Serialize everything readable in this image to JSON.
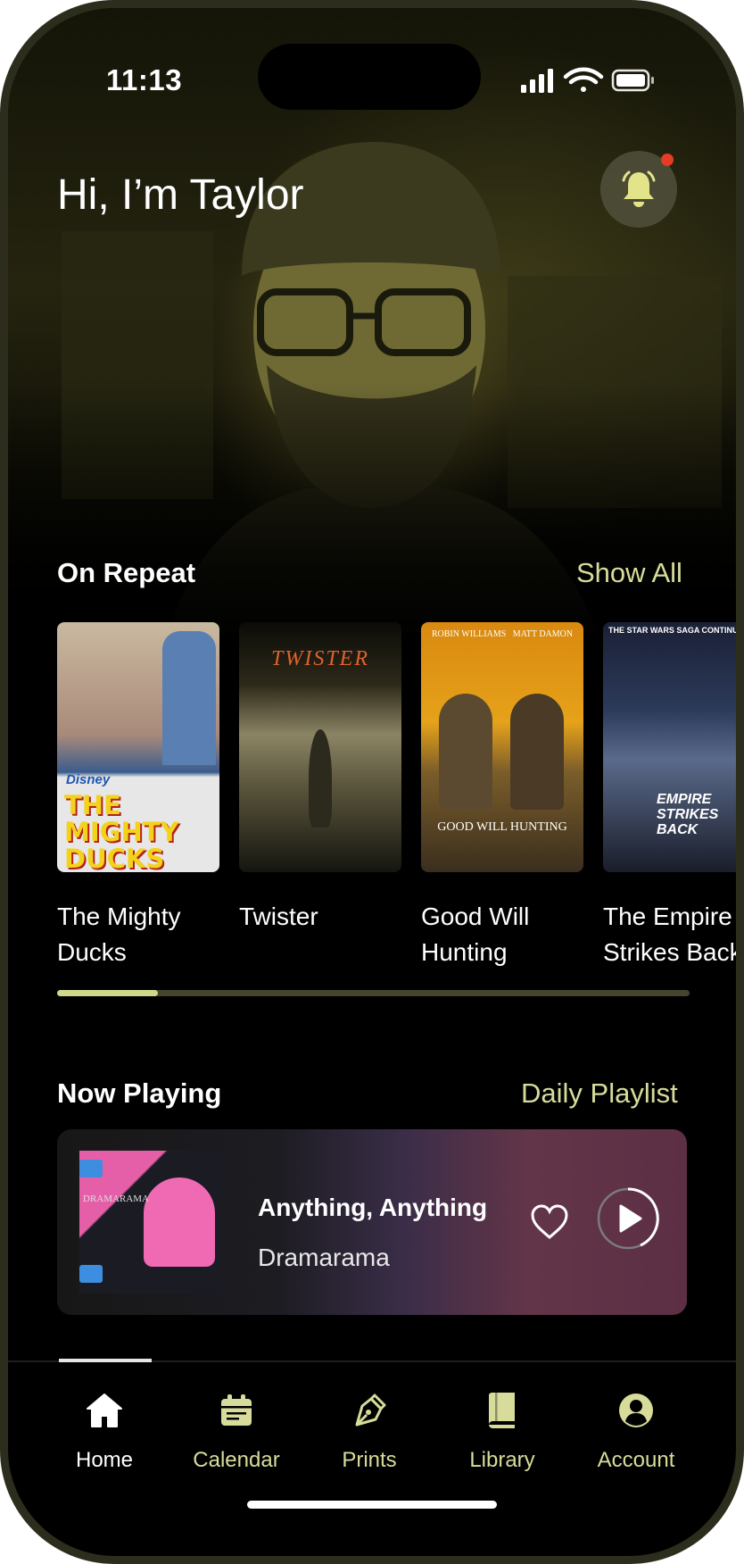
{
  "status": {
    "time": "11:13"
  },
  "header": {
    "greeting": "Hi, I’m Taylor",
    "bell_icon": "bell-icon"
  },
  "on_repeat": {
    "title": "On Repeat",
    "link": "Show All",
    "scroll_progress": 0.16,
    "movies": [
      {
        "title": "The Mighty\nDucks",
        "poster_text": "THE MIGHTY DUCKS",
        "poster_brand": "Disney"
      },
      {
        "title": "Twister",
        "poster_text": "TWISTER"
      },
      {
        "title": "Good Will\nHunting",
        "poster_text": "GOOD WILL HUNTING",
        "poster_credits": "ROBIN WILLIAMS   MATT DAMON"
      },
      {
        "title": "The Empire\nStrikes Back",
        "poster_text": "EMPIRE STRIKES BACK",
        "poster_header": "THE STAR WARS SAGA CONTINUES"
      }
    ]
  },
  "now_playing": {
    "title": "Now Playing",
    "link": "Daily Playlist",
    "track": "Anything, Anything",
    "artist": "Dramarama",
    "album_text": "DRAMARAMA"
  },
  "tabs": [
    {
      "label": "Home",
      "icon": "home-icon",
      "active": true
    },
    {
      "label": "Calendar",
      "icon": "calendar-icon",
      "active": false
    },
    {
      "label": "Prints",
      "icon": "pen-nib-icon",
      "active": false
    },
    {
      "label": "Library",
      "icon": "book-icon",
      "active": false
    },
    {
      "label": "Account",
      "icon": "user-icon",
      "active": false
    }
  ],
  "colors": {
    "accent": "#d8dc9a",
    "notification": "#e63c26",
    "background": "#000000"
  }
}
